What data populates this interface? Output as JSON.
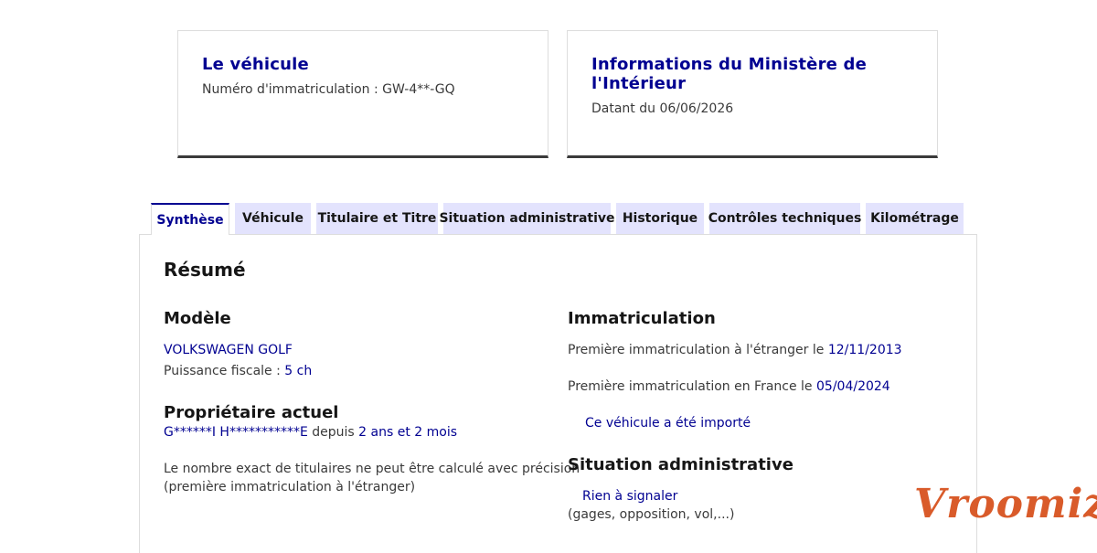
{
  "vehicle_card": {
    "title": "Le véhicule",
    "plate_label": "Numéro d'immatriculation :",
    "plate_value": "GW-4**-GQ"
  },
  "ministry_card": {
    "title": "Informations du Ministère de l'Intérieur",
    "date_label": "Datant du",
    "date_value": "06/06/2026"
  },
  "tabs": [
    {
      "label": "Synthèse",
      "active": true
    },
    {
      "label": "Véhicule",
      "active": false
    },
    {
      "label": "Titulaire et Titre",
      "active": false
    },
    {
      "label": "Situation administrative",
      "active": false
    },
    {
      "label": "Historique",
      "active": false
    },
    {
      "label": "Contrôles techniques",
      "active": false
    },
    {
      "label": "Kilométrage",
      "active": false
    }
  ],
  "summary": {
    "title": "Résumé",
    "model": {
      "heading": "Modèle",
      "name": "VOLKSWAGEN GOLF",
      "power_label": "Puissance fiscale :",
      "power_value": "5 ch"
    },
    "owner": {
      "heading": "Propriétaire actuel",
      "name": "G******I H***********E",
      "since_label": "depuis",
      "since_value": "2 ans et 2 mois",
      "note_line1": "Le nombre exact de titulaires ne peut être calculé avec précision",
      "note_line2": "(première immatriculation à l'étranger)"
    },
    "registration": {
      "heading": "Immatriculation",
      "foreign_label": "Première immatriculation à l'étranger le",
      "foreign_date": "12/11/2013",
      "france_label": "Première immatriculation en France le",
      "france_date": "05/04/2024",
      "imported_text": "Ce véhicule a été importé"
    },
    "admin": {
      "heading": "Situation administrative",
      "status": "Rien à signaler",
      "details": "(gages, opposition, vol,...)"
    }
  },
  "brand": {
    "logo_text": "Vroomiz",
    "color": "#d95b2a"
  },
  "colors": {
    "accent": "#000091",
    "tab_bg": "#e3e3fd"
  }
}
